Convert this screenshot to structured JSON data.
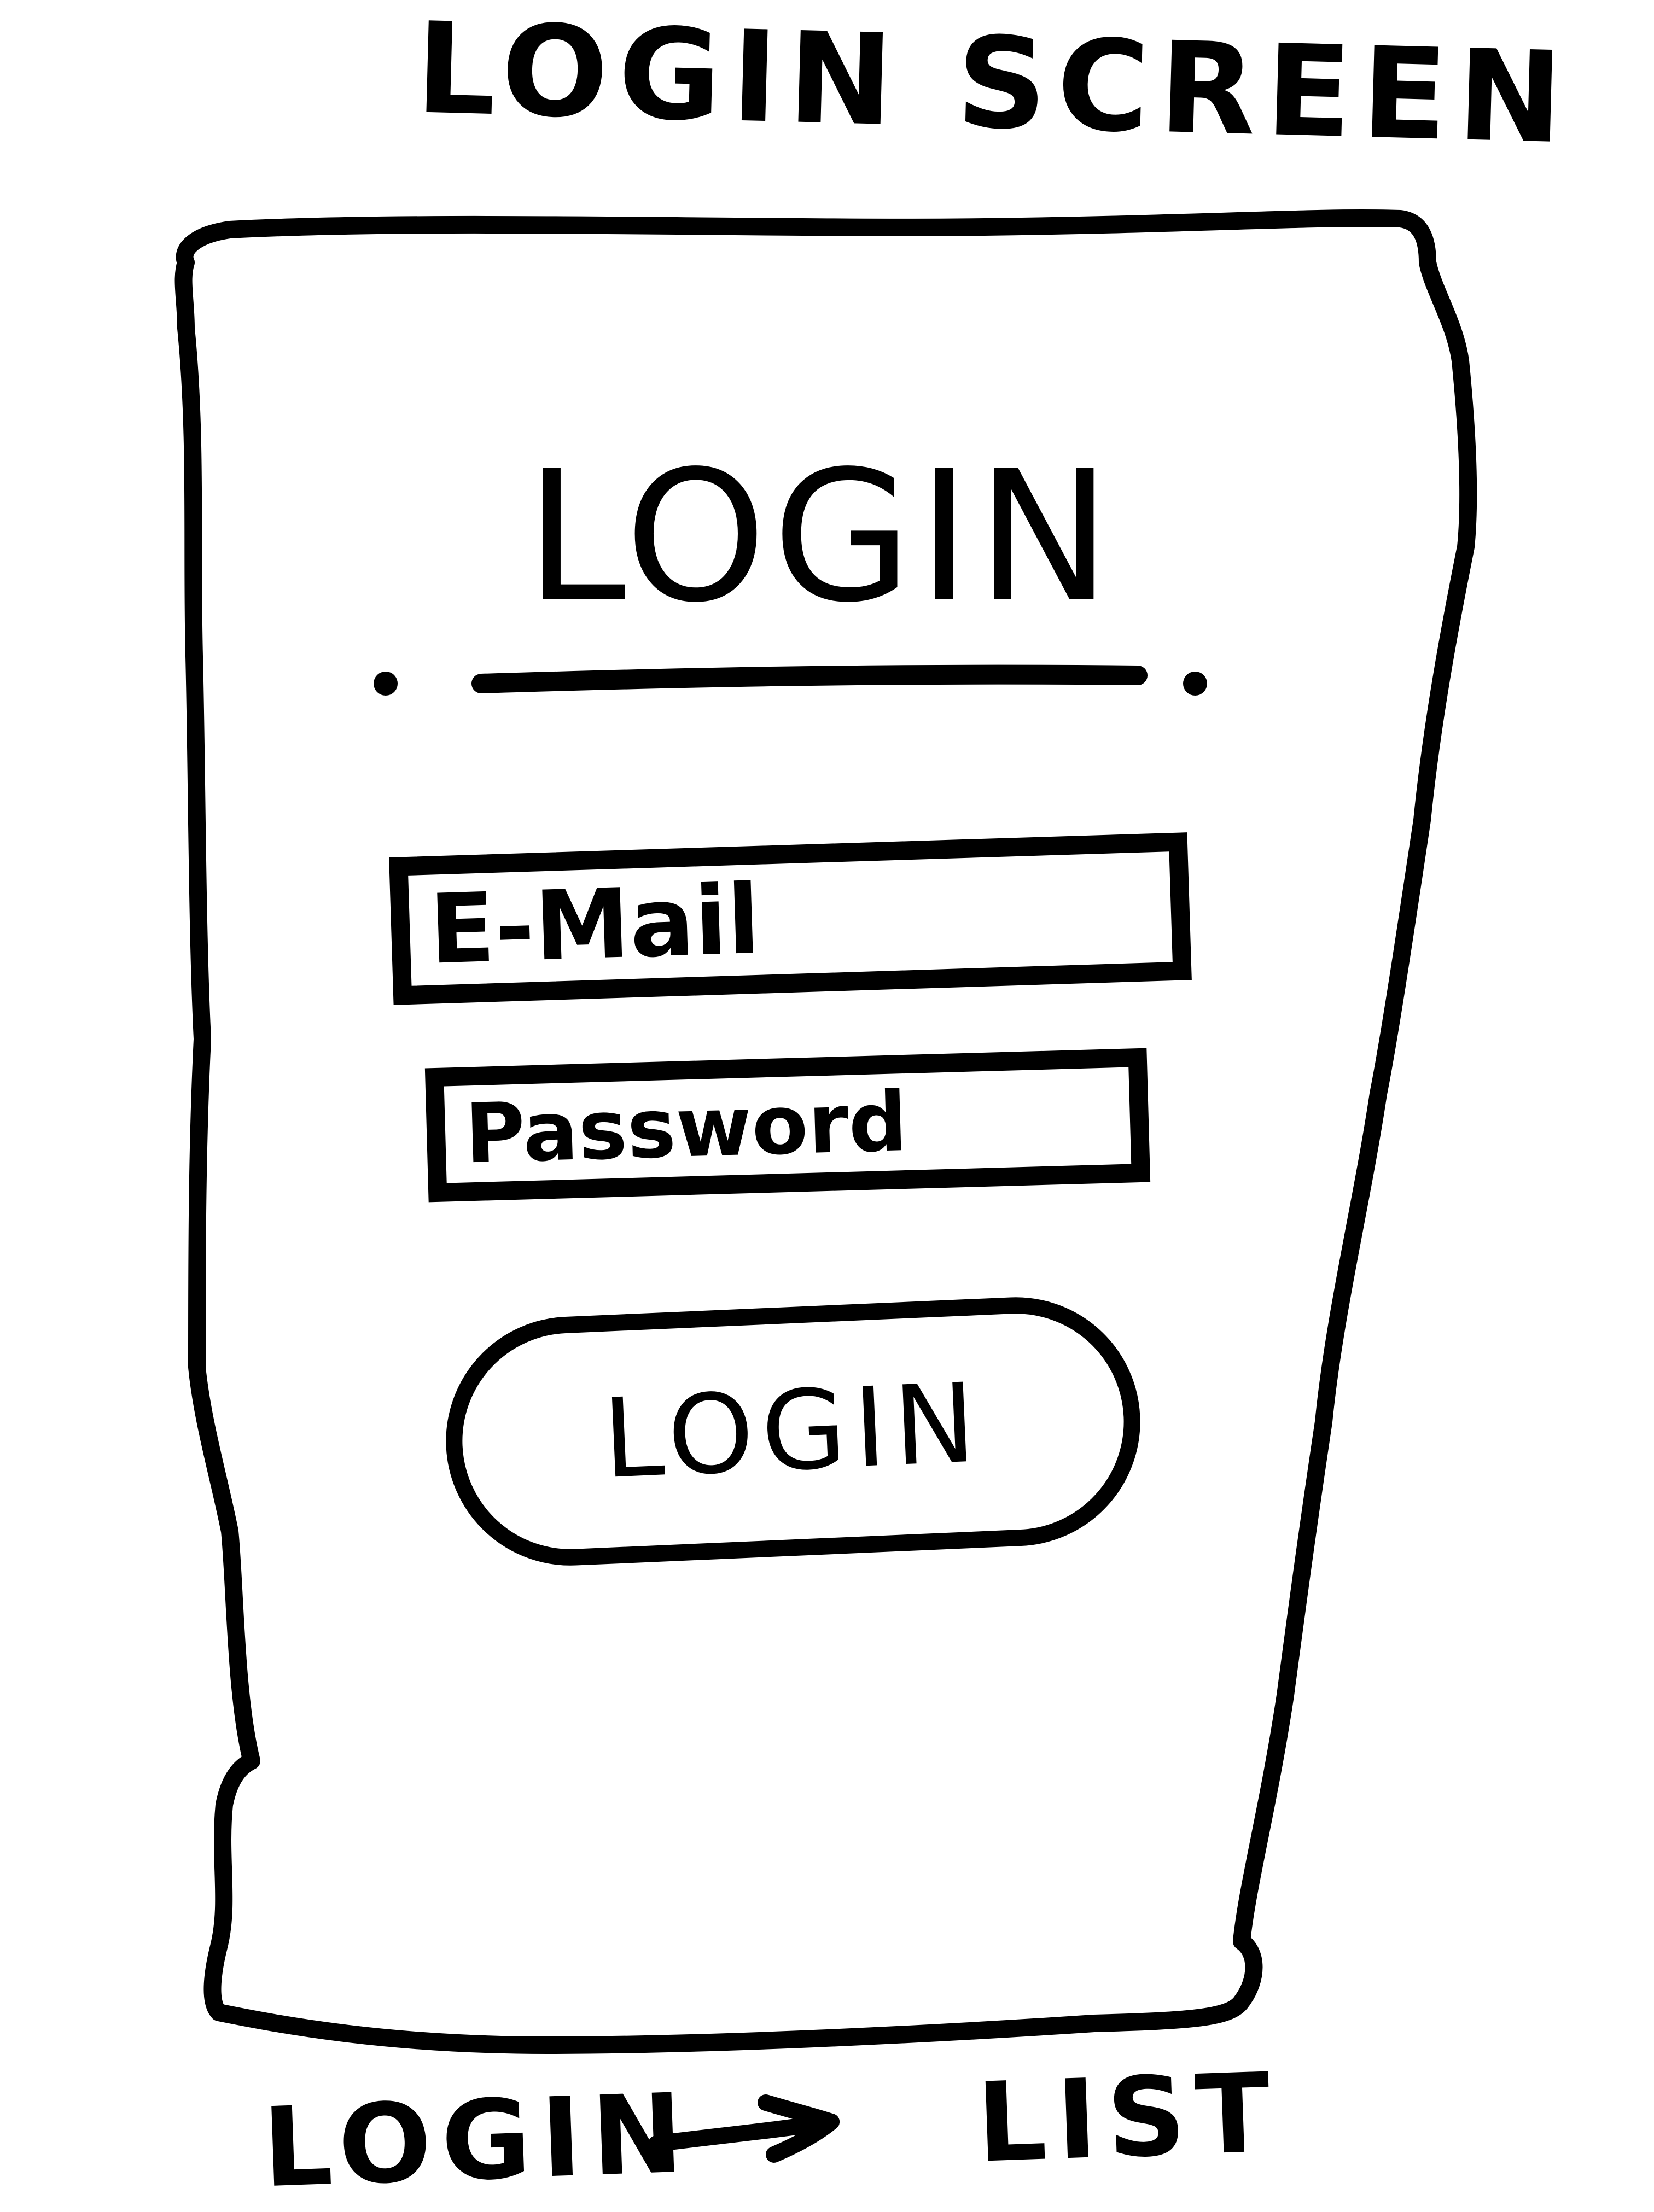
{
  "sketch": {
    "title": "LOGIN SCREEN",
    "flow": {
      "from": "LOGIN",
      "to": "LIST"
    }
  },
  "screen": {
    "heading": "LOGIN",
    "email": {
      "placeholder": "E-Mail",
      "value": ""
    },
    "password": {
      "placeholder": "Password",
      "value": ""
    },
    "login_button_label": "LOGIN"
  },
  "colors": {
    "ink": "#000000",
    "paper": "#ffffff"
  }
}
